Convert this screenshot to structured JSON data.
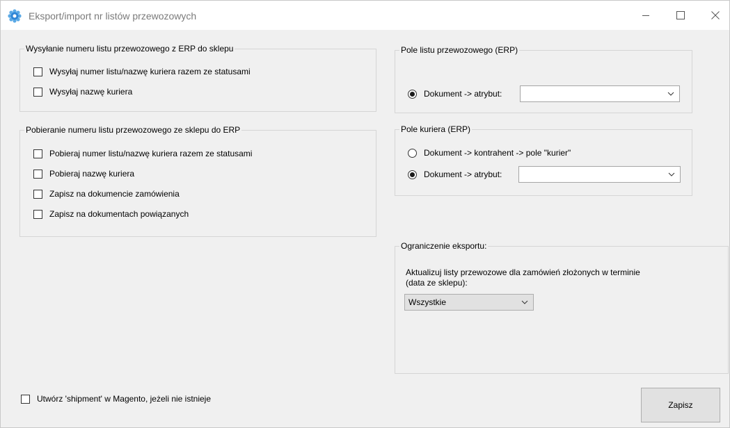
{
  "window": {
    "title": "Eksport/import nr listów przewozowych",
    "icon": "gear-icon",
    "controls": [
      "minimize-icon",
      "maximize-icon",
      "close-icon"
    ]
  },
  "send_group": {
    "legend": "Wysyłanie numeru listu przewozowego z ERP do sklepu",
    "options": [
      {
        "label": "Wysyłaj numer listu/nazwę kuriera razem ze statusami",
        "checked": false
      },
      {
        "label": "Wysyłaj nazwę kuriera",
        "checked": false
      }
    ]
  },
  "fetch_group": {
    "legend": "Pobieranie numeru listu przewozowego ze sklepu do ERP",
    "options": [
      {
        "label": "Pobieraj numer listu/nazwę kuriera razem ze statusami",
        "checked": false
      },
      {
        "label": "Pobieraj nazwę kuriera",
        "checked": false
      },
      {
        "label": "Zapisz na dokumencie zamówienia",
        "checked": false
      },
      {
        "label": "Zapisz na dokumentach powiązanych",
        "checked": false
      }
    ]
  },
  "waybill_field": {
    "legend": "Pole listu przewozowego (ERP)",
    "radio_label": "Dokument -> atrybut:",
    "selected": true,
    "combo_value": ""
  },
  "courier_field": {
    "legend": "Pole kuriera (ERP)",
    "options": [
      {
        "label": "Dokument -> kontrahent -> pole \"kurier\"",
        "selected": false
      },
      {
        "label": "Dokument -> atrybut:",
        "selected": true
      }
    ],
    "combo_value": ""
  },
  "export_limit": {
    "legend": "Ograniczenie eksportu:",
    "description_line1": "Aktualizuj listy przewozowe dla zamówień złożonych w terminie",
    "description_line2": "(data ze sklepu):",
    "combo_value": "Wszystkie"
  },
  "footer": {
    "shipment_label": "Utwórz 'shipment' w Magento, jeżeli nie istnieje",
    "shipment_checked": false,
    "save_label": "Zapisz"
  }
}
